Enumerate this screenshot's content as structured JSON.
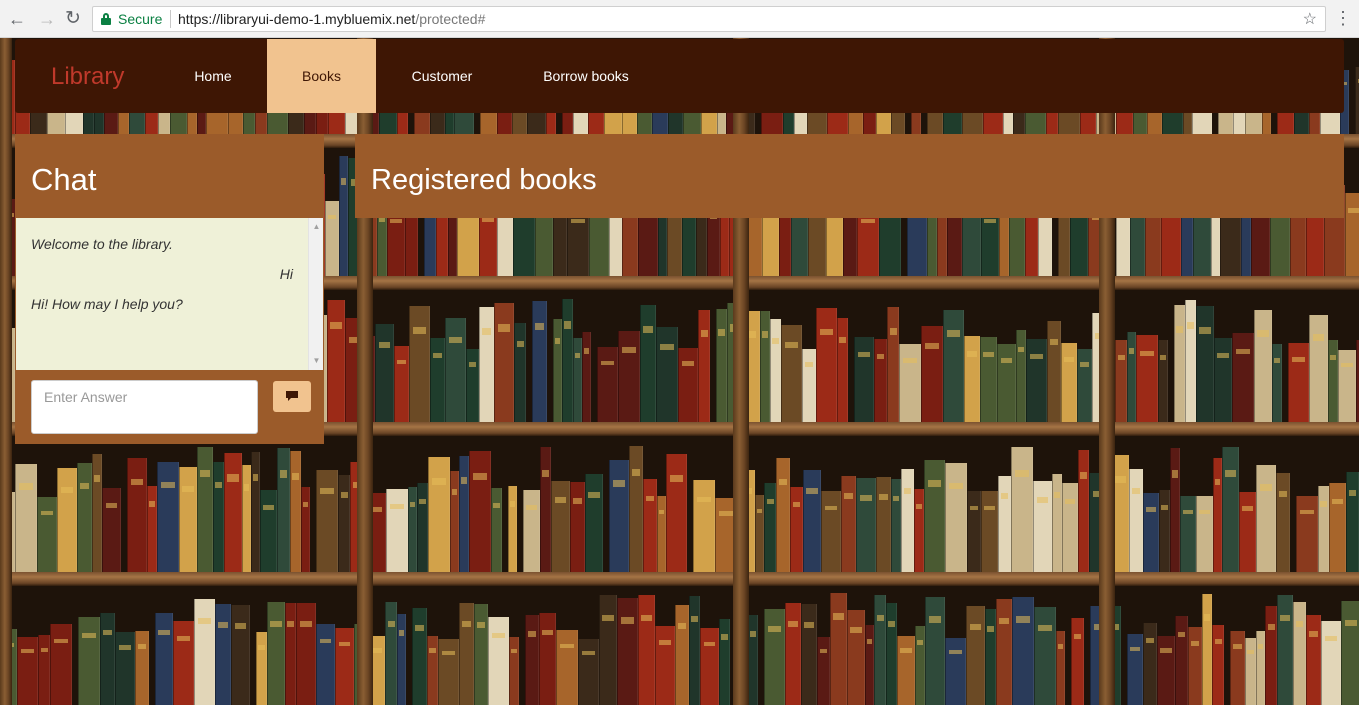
{
  "browser": {
    "secure_label": "Secure",
    "url_host": "https://libraryui-demo-1.mybluemix.net",
    "url_path": "/protected#",
    "icons": [
      "back-icon",
      "forward-icon",
      "reload-icon",
      "lock-icon",
      "star-icon",
      "menu-icon"
    ]
  },
  "navbar": {
    "brand": "Library",
    "items": [
      {
        "label": "Home",
        "active": false
      },
      {
        "label": "Books",
        "active": true
      },
      {
        "label": "Customer",
        "active": false
      },
      {
        "label": "Borrow books",
        "active": false
      }
    ]
  },
  "chat": {
    "title": "Chat",
    "messages": [
      {
        "text": "Welcome to the library.",
        "from": "bot"
      },
      {
        "text": "Hi",
        "from": "user"
      },
      {
        "text": "Hi! How may I help you?",
        "from": "bot"
      }
    ],
    "input_placeholder": "Enter Answer",
    "send_icon": "comment-icon"
  },
  "books_panel": {
    "title": "Registered books"
  },
  "colors": {
    "navbar_bg": "#3e1604",
    "brand_text": "#c0392b",
    "active_tab_bg": "#f1c38f",
    "panel_bg": "#9b5b2a",
    "chat_bg": "#eff1d8",
    "secure_green": "#0b8043"
  }
}
